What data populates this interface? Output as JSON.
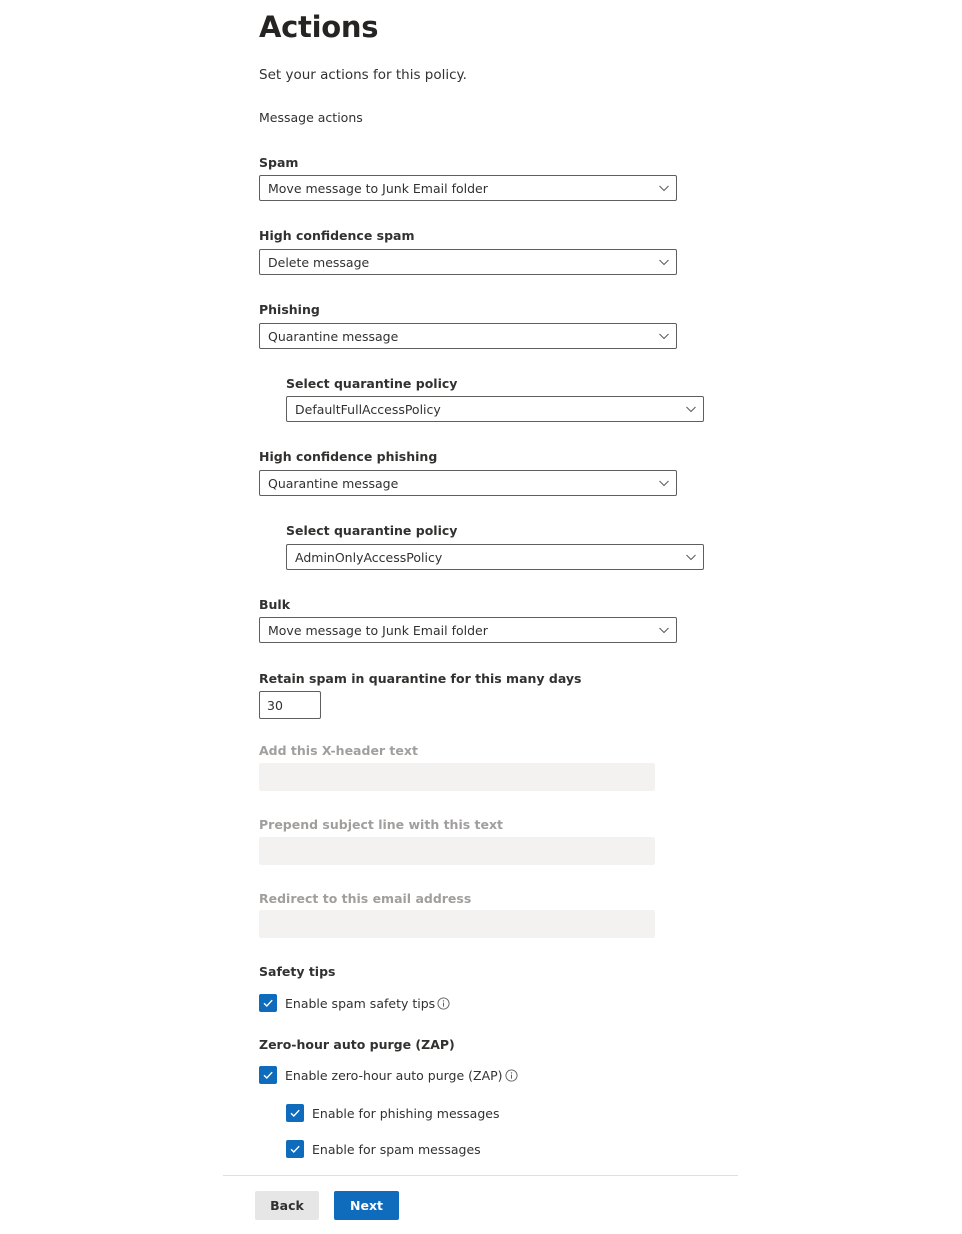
{
  "header": {
    "title": "Actions",
    "subtitle": "Set your actions for this policy."
  },
  "message_actions": {
    "heading": "Message actions",
    "spam": {
      "label": "Spam",
      "value": "Move message to Junk Email folder"
    },
    "high_confidence_spam": {
      "label": "High confidence spam",
      "value": "Delete message"
    },
    "phishing": {
      "label": "Phishing",
      "value": "Quarantine message",
      "quarantine_policy": {
        "label": "Select quarantine policy",
        "value": "DefaultFullAccessPolicy"
      }
    },
    "high_confidence_phishing": {
      "label": "High confidence phishing",
      "value": "Quarantine message",
      "quarantine_policy": {
        "label": "Select quarantine policy",
        "value": "AdminOnlyAccessPolicy"
      }
    },
    "bulk": {
      "label": "Bulk",
      "value": "Move message to Junk Email folder"
    },
    "retain_days": {
      "label": "Retain spam in quarantine for this many days",
      "value": "30"
    },
    "x_header": {
      "label": "Add this X-header text",
      "value": ""
    },
    "prepend_subject": {
      "label": "Prepend subject line with this text",
      "value": ""
    },
    "redirect_email": {
      "label": "Redirect to this email address",
      "value": ""
    }
  },
  "safety_tips": {
    "heading": "Safety tips",
    "enable_spam_safety_tips": {
      "label": "Enable spam safety tips",
      "checked": true
    }
  },
  "zap": {
    "heading": "Zero-hour auto purge (ZAP)",
    "enable_zap": {
      "label": "Enable zero-hour auto purge (ZAP)",
      "checked": true
    },
    "enable_phishing": {
      "label": "Enable for phishing messages",
      "checked": true
    },
    "enable_spam": {
      "label": "Enable for spam messages",
      "checked": true
    }
  },
  "footer": {
    "back_label": "Back",
    "next_label": "Next"
  },
  "colors": {
    "primary": "#0f6cbd",
    "border": "#605e5c",
    "disabled_bg": "#f3f2f1",
    "disabled_text": "#a19f9d"
  },
  "icons": {
    "chevron": "chevron-down-icon",
    "check": "checkmark-icon",
    "info": "info-icon"
  }
}
